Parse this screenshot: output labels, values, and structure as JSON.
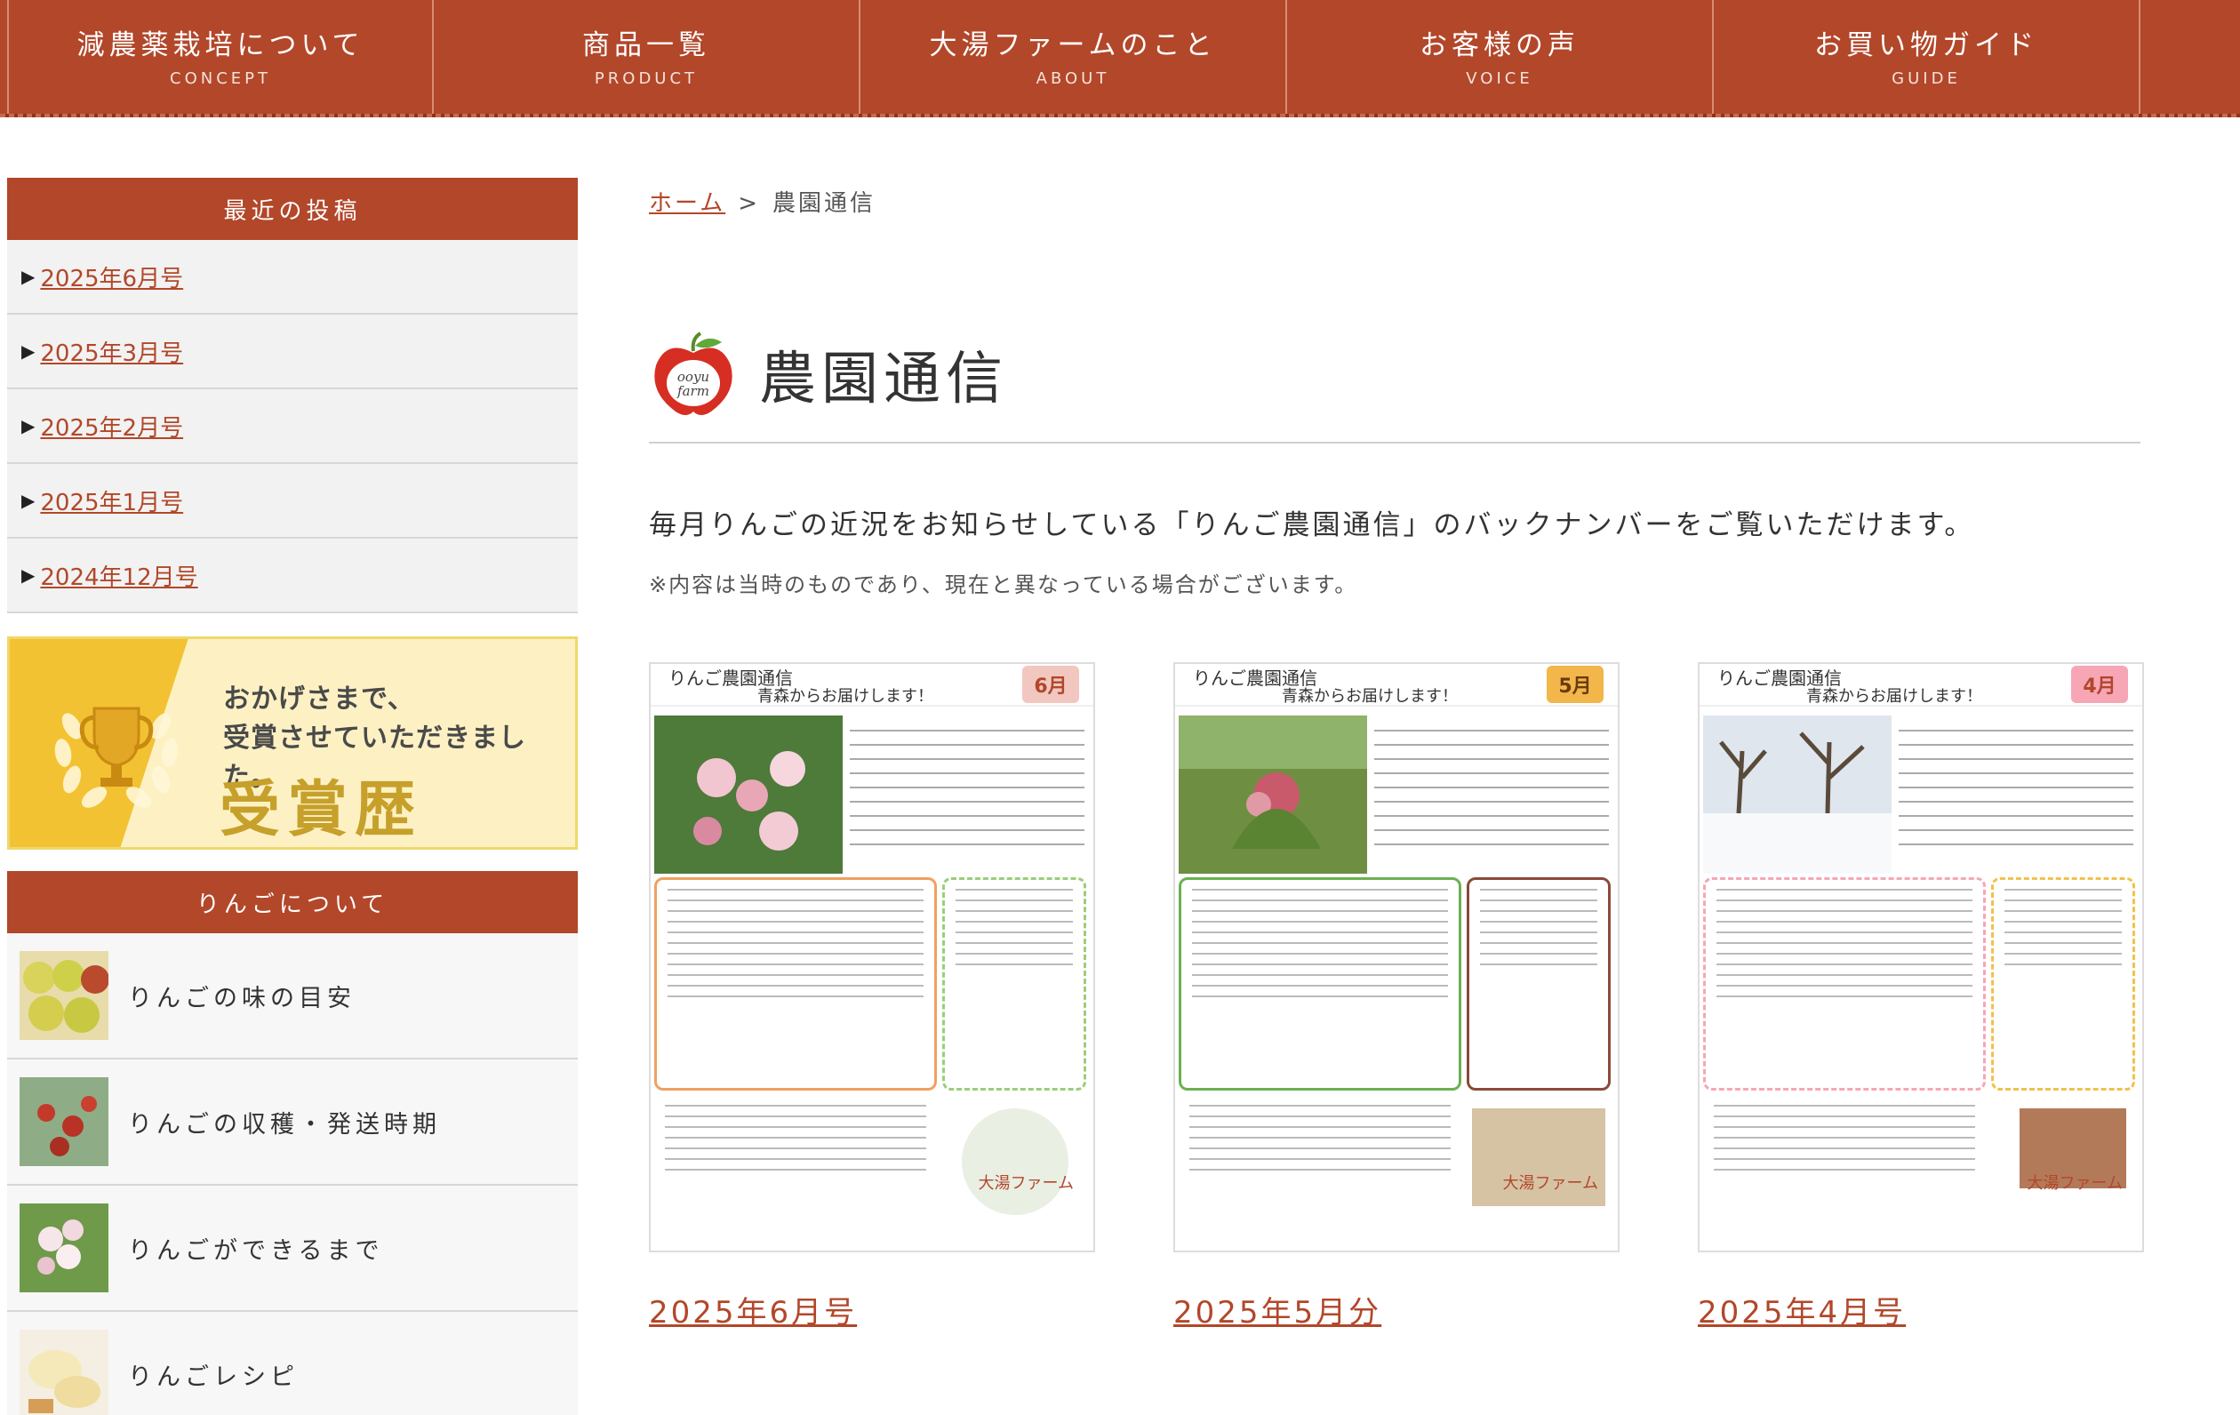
{
  "nav": [
    {
      "jp": "減農薬栽培について",
      "en": "CONCEPT"
    },
    {
      "jp": "商品一覧",
      "en": "PRODUCT"
    },
    {
      "jp": "大湯ファームのこと",
      "en": "ABOUT"
    },
    {
      "jp": "お客様の声",
      "en": "VOICE"
    },
    {
      "jp": "お買い物ガイド",
      "en": "GUIDE"
    }
  ],
  "sidebar": {
    "recent_heading": "最近の投稿",
    "posts": [
      "2025年6月号",
      "2025年3月号",
      "2025年2月号",
      "2025年1月号",
      "2024年12月号"
    ],
    "award": {
      "line1": "おかげさまで、",
      "line2": "受賞させていただきました。",
      "title": "受賞歴"
    },
    "apple_heading": "りんごについて",
    "apple_links": [
      "りんごの味の目安",
      "りんごの収穫・発送時期",
      "りんごができるまで",
      "りんごレシピ"
    ]
  },
  "breadcrumb": {
    "home": "ホーム",
    "separator": ">",
    "current": "農園通信"
  },
  "page_title": "農園通信",
  "logo_text": "ooyu farm",
  "lead": "毎月りんごの近況をお知らせしている「りんご農園通信」のバックナンバーをご覧いただけます。",
  "note": "※内容は当時のものであり、現在と異なっている場合がございます。",
  "newsletters": [
    {
      "caption": "2025年6月号",
      "header": "りんご農園通信",
      "sub": "青森からお届けします！",
      "month_badge": "6月",
      "badge_color": "#f1c7c0",
      "brand": "大湯ファーム"
    },
    {
      "caption": "2025年5月分",
      "header": "りんご農園通信",
      "sub": "青森からお届けします！",
      "month_badge": "5月",
      "badge_color": "#f2b64a",
      "brand": "大湯ファーム"
    },
    {
      "caption": "2025年4月号",
      "header": "りんご農園通信",
      "sub": "青森からお届けします！",
      "month_badge": "4月",
      "badge_color": "#f6a6b5",
      "brand": "大湯ファーム"
    }
  ]
}
